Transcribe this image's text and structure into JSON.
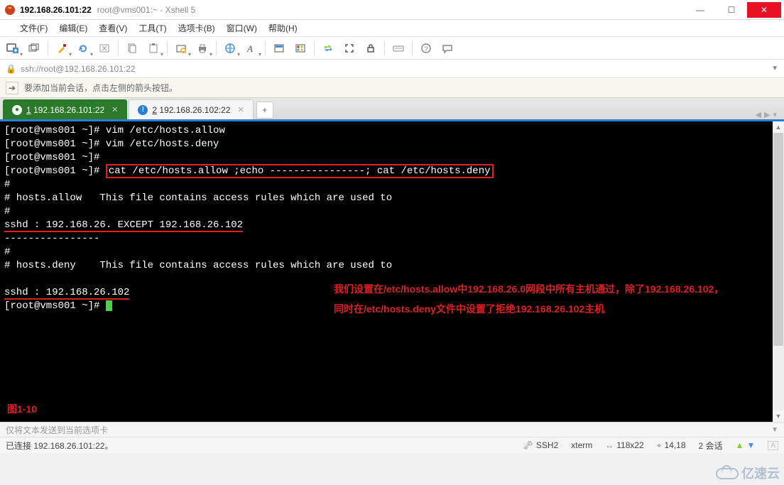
{
  "titlebar": {
    "address": "192.168.26.101:22",
    "path": "root@vms001:~ - Xshell 5"
  },
  "menubar": [
    "文件(F)",
    "编辑(E)",
    "查看(V)",
    "工具(T)",
    "选项卡(B)",
    "窗口(W)",
    "帮助(H)"
  ],
  "addressbar": {
    "url": "ssh://root@192.168.26.101:22"
  },
  "promptbar": {
    "text": "要添加当前会话，点击左侧的箭头按钮。"
  },
  "tabs": [
    {
      "num": "1",
      "label": "192.168.26.101:22",
      "active": true
    },
    {
      "num": "2",
      "label": "192.168.26.102:22",
      "active": false
    }
  ],
  "terminal": {
    "l1": "[root@vms001 ~]# vim /etc/hosts.allow",
    "l2": "[root@vms001 ~]# vim /etc/hosts.deny",
    "l3a": "[root@vms001 ~]#",
    "l3b": "[root@vms001 ~]# ",
    "cmd": "cat /etc/hosts.allow ;echo ----------------; cat /etc/hosts.deny",
    "l4": "#",
    "l5": "# hosts.allow   This file contains access rules which are used to",
    "l6": "#",
    "l7": "sshd : 192.168.26. EXCEPT 192.168.26.102",
    "l8": "----------------",
    "l9": "#",
    "l10": "# hosts.deny    This file contains access rules which are used to",
    "l11": "",
    "l12": "sshd : 192.168.26.102",
    "l13": "[root@vms001 ~]# ",
    "note": "我们设置在/etc/hosts.allow中192.168.26.0网段中所有主机通过，除了192.168.26.102，同时在/etc/hosts.deny文件中设置了拒绝192.168.26.102主机",
    "figure": "图1-10"
  },
  "sendrow": {
    "placeholder": "仅将文本发送到当前选项卡"
  },
  "statusbar": {
    "left": "已连接 192.168.26.101:22。",
    "ssh": "SSH2",
    "term": "xterm",
    "size": "118x22",
    "pos": "14,18",
    "sessions": "2 会话"
  },
  "watermark": "亿速云",
  "icons": {
    "arrow_right": "➔"
  }
}
